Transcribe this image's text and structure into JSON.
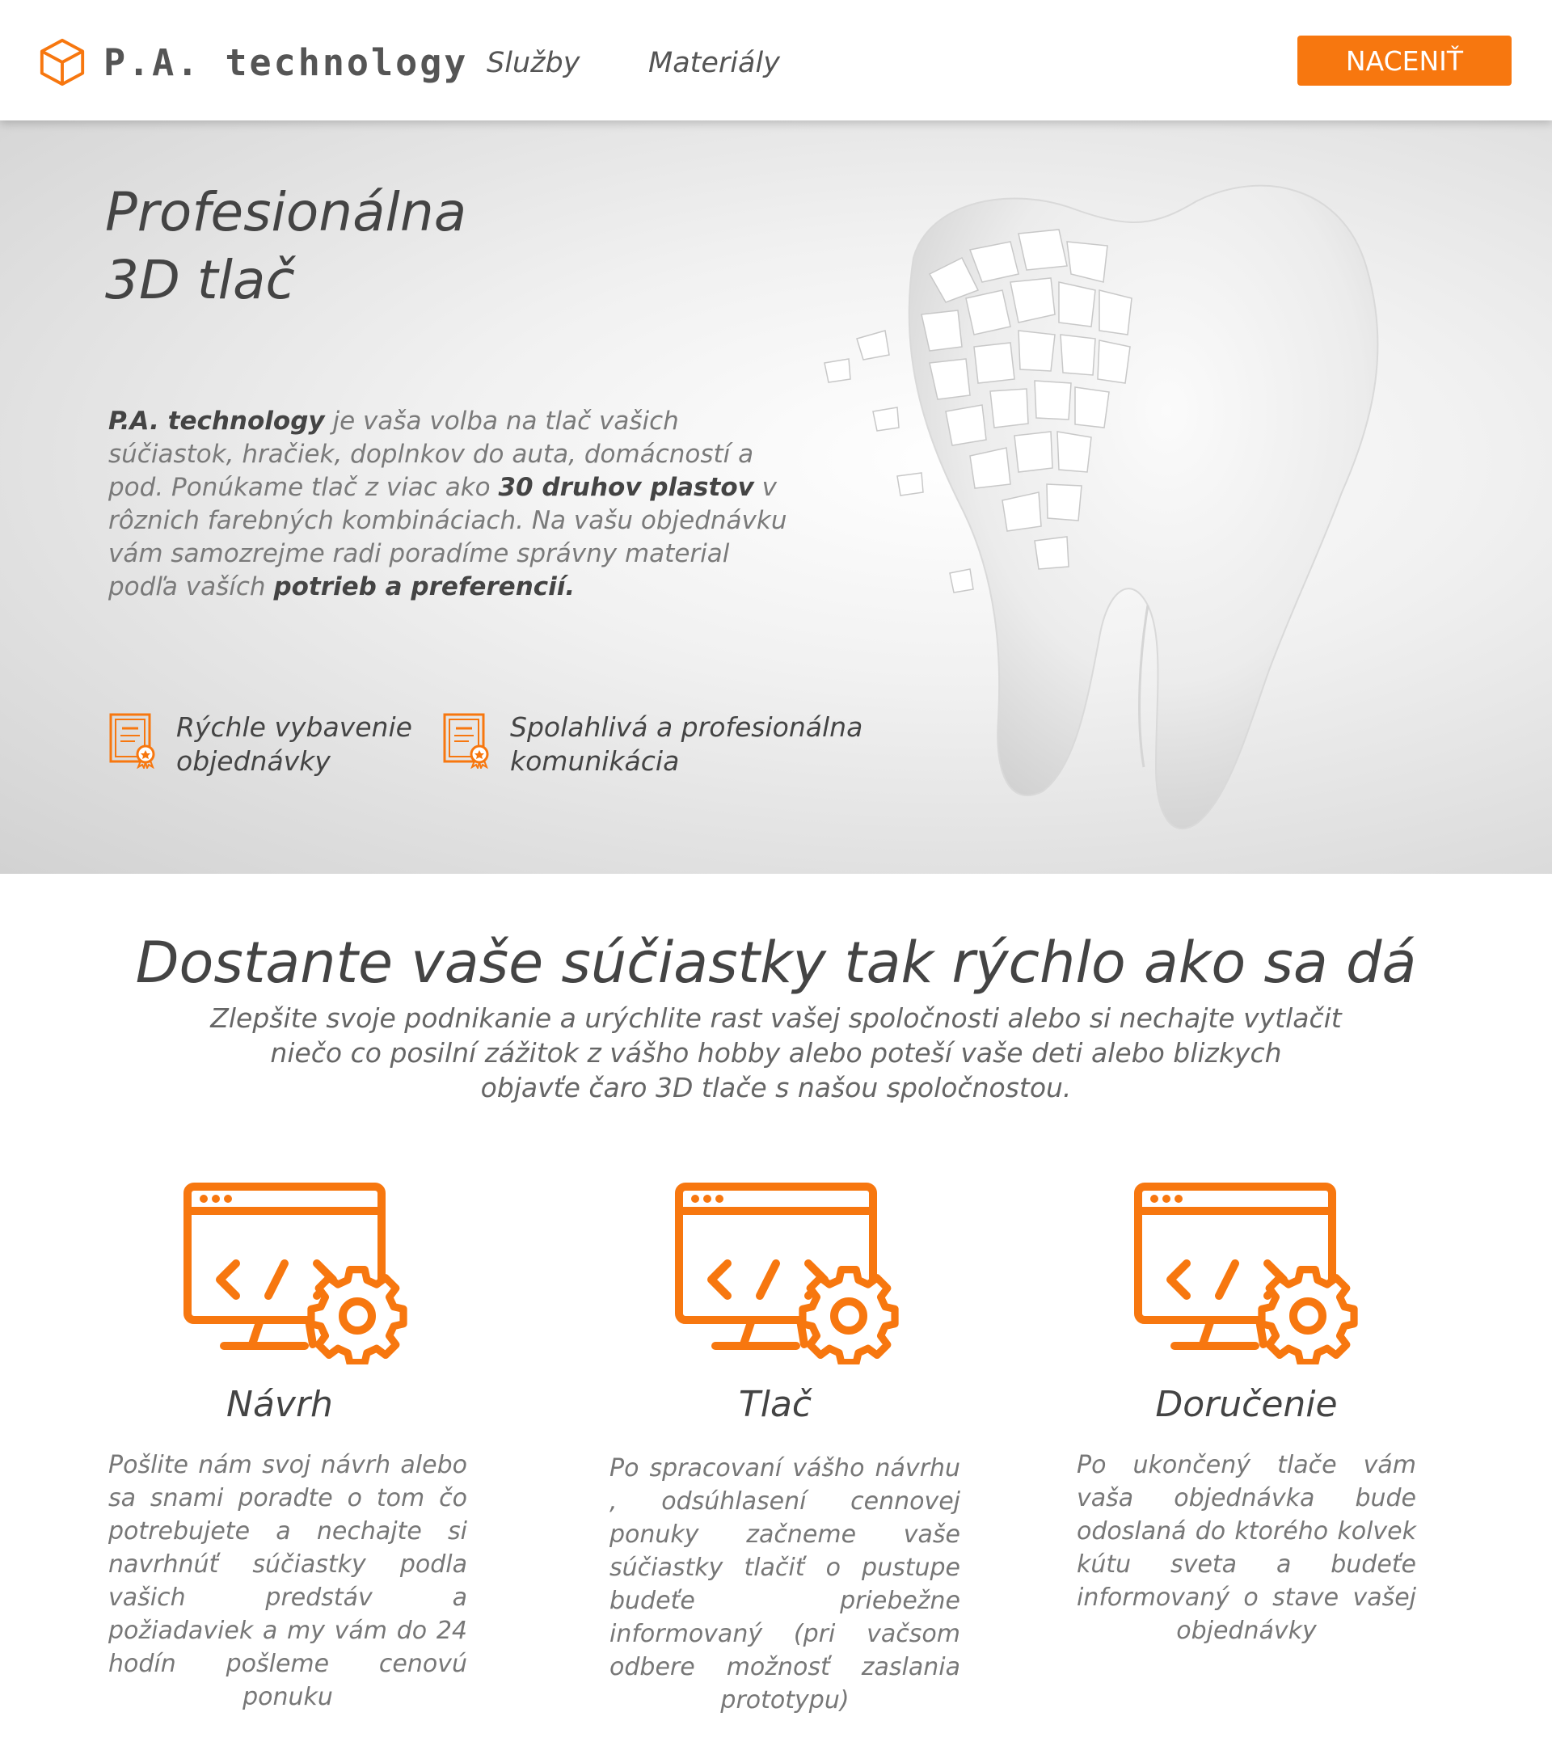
{
  "header": {
    "brand": "P.A. technology",
    "nav": [
      "Služby",
      "Materiály"
    ],
    "cta": "NACENIŤ"
  },
  "hero": {
    "title_line1": "Profesionálna",
    "title_line2": "3D tlač",
    "desc": {
      "brand": "P.A. technology",
      "part1": " je vaša volba na tlač vašich súčiastok, hračiek, doplnkov do auta, domácností a pod. Ponúkame tlač z viac ako ",
      "bold_plastics": "30 druhov plastov",
      "part2": " v rôznich farebných kombináciach. Na vašu objednávku vám samozrejme  radi poradíme správny material podľa vaších ",
      "bold_needs": "potrieb a preferencií."
    },
    "features": [
      {
        "line1": "Rýchle vybavenie",
        "line2": "objednávky",
        "icon": "certificate-icon"
      },
      {
        "line1": "Spolahlivá a profesionálna",
        "line2": "komunikácia",
        "icon": "certificate-icon"
      }
    ]
  },
  "section2": {
    "title": "Dostante vaše súčiastky tak rýchlo ako sa dá",
    "subtitle_lines": [
      "Zlepšite svoje podnikanie a urýchlite rast vašej spoločnosti alebo si nechajte vytlačit",
      "niečo co posilní zážitok z vášho hobby alebo poteší vaše deti alebo blizkych",
      "objavťe čaro 3D tlače s našou spoločnostou."
    ],
    "cards": [
      {
        "title": "Návrh",
        "icon": "monitor-code-gear-icon",
        "text": "Pošlite nám svoj návrh alebo sa snami poradte o tom čo potrebujete a nechajte si navrhnúť súčiastky podla vašich predstáv a požiadaviek a my vám do 24 hodín pošleme cenovú ponuku"
      },
      {
        "title": "Tlač",
        "icon": "monitor-code-gear-icon",
        "text": "Po spracovaní vášho návrhu , odsúhlasení cennovej ponuky začneme vaše súčiastky tlačiť o pustupe budeťe priebežne informovaný (pri vačsom odbere možnosť zaslania prototypu)"
      },
      {
        "title": "Doručenie",
        "icon": "monitor-code-gear-icon",
        "text": "Po ukončený tlače vám vaša objednávka bude odoslaná do ktorého kolvek kútu sveta a budeťe informovaný o stave vašej objednávky"
      }
    ]
  },
  "colors": {
    "accent": "#f7770f",
    "text": "#444444",
    "muted": "#777777"
  }
}
